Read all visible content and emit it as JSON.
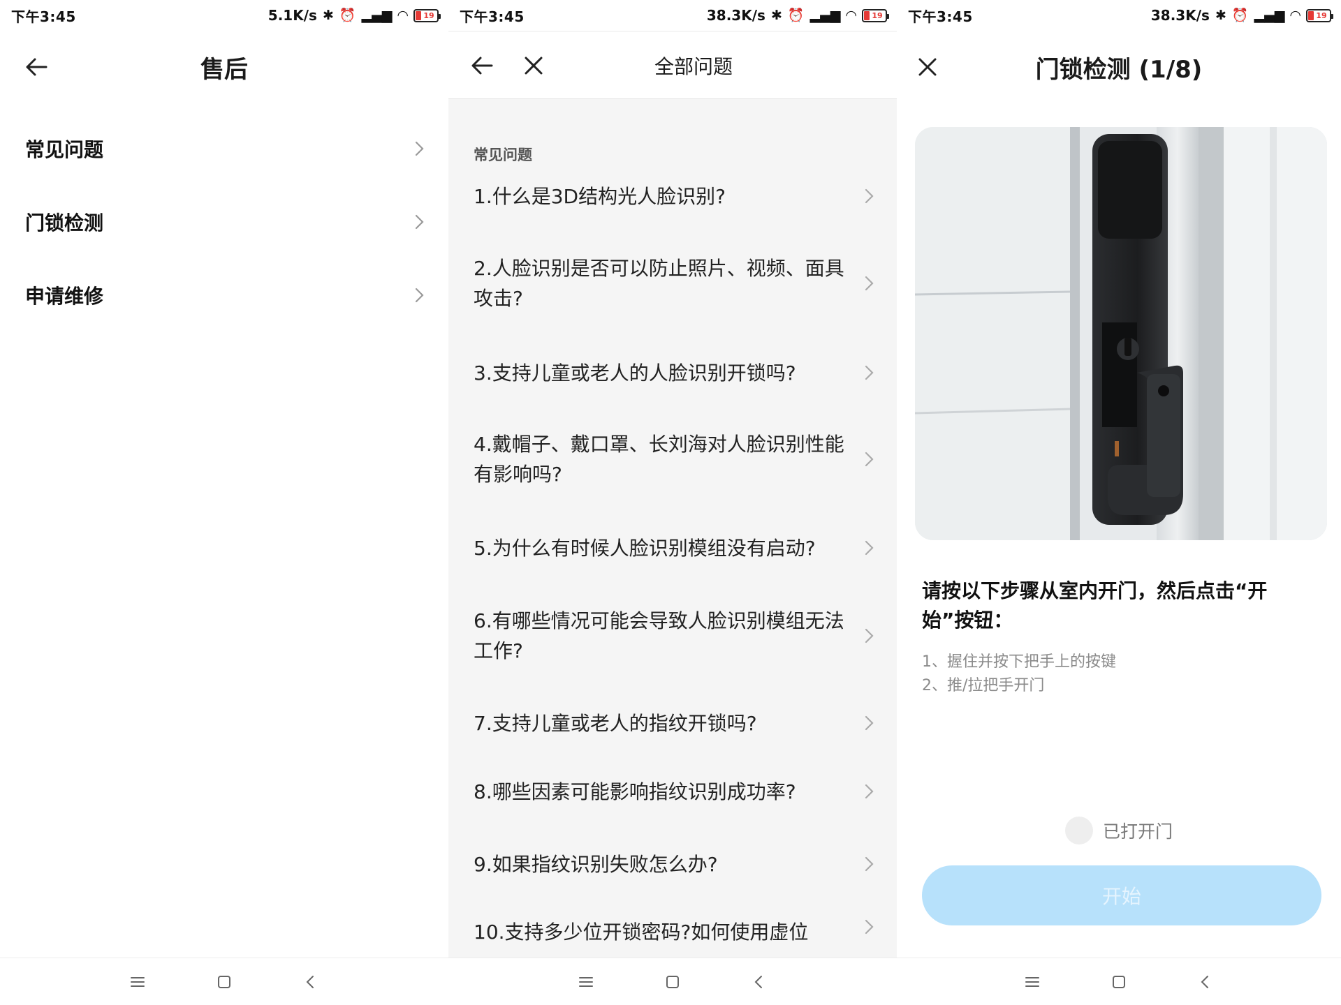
{
  "screens": [
    {
      "status": {
        "time": "下午3:45",
        "speed": "5.1K/s",
        "battery": "19"
      },
      "title": "售后",
      "items": [
        {
          "label": "常见问题"
        },
        {
          "label": "门锁检测"
        },
        {
          "label": "申请维修"
        }
      ]
    },
    {
      "status": {
        "time": "下午3:45",
        "speed": "38.3K/s",
        "battery": "19"
      },
      "title": "全部问题",
      "section": "常见问题",
      "faq": [
        "1.什么是3D结构光人脸识别?",
        "2.人脸识别是否可以防止照片、视频、面具攻击?",
        "3.支持儿童或老人的人脸识别开锁吗?",
        "4.戴帽子、戴口罩、长刘海对人脸识别性能有影响吗?",
        "5.为什么有时候人脸识别模组没有启动?",
        "6.有哪些情况可能会导致人脸识别模组无法工作?",
        "7.支持儿童或老人的指纹开锁吗?",
        "8.哪些因素可能影响指纹识别成功率?",
        "9.如果指纹识别失败怎么办?",
        "10.支持多少位开锁密码?如何使用虚位"
      ]
    },
    {
      "status": {
        "time": "下午3:45",
        "speed": "38.3K/s",
        "battery": "19"
      },
      "title": "门锁检测 (1/8)",
      "instruction": "请按以下步骤从室内开门，然后点击“开始”按钮：",
      "steps": [
        "1、握住并按下把手上的按键",
        "2、推/拉把手开门"
      ],
      "checkbox_label": "已打开门",
      "start_label": "开始"
    }
  ],
  "icons": {
    "status": [
      "bluetooth-icon",
      "alarm-icon",
      "hd-signal-icon",
      "wifi-icon",
      "battery-icon"
    ],
    "nav": [
      "menu-icon",
      "home-icon",
      "back-icon"
    ]
  },
  "colors": {
    "accent_disabled": "#b7e1fb",
    "faq_bg": "#f5f5f5"
  }
}
